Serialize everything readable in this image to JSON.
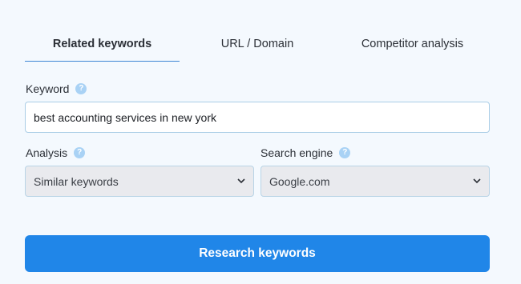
{
  "tabs": [
    {
      "label": "Related keywords",
      "active": true
    },
    {
      "label": "URL / Domain",
      "active": false
    },
    {
      "label": "Competitor analysis",
      "active": false
    }
  ],
  "keyword": {
    "label": "Keyword",
    "value": "best accounting services in new york",
    "help_icon": "question-mark"
  },
  "analysis": {
    "label": "Analysis",
    "selected": "Similar keywords",
    "help_icon": "question-mark"
  },
  "search_engine": {
    "label": "Search engine",
    "selected": "Google.com",
    "help_icon": "question-mark"
  },
  "research_button": {
    "label": "Research keywords"
  },
  "colors": {
    "background": "#f4f9fe",
    "accent": "#2086e8",
    "tab_underline": "#3d86d4",
    "help_icon": "#a9d2f5",
    "select_bg": "#e9eaee"
  }
}
